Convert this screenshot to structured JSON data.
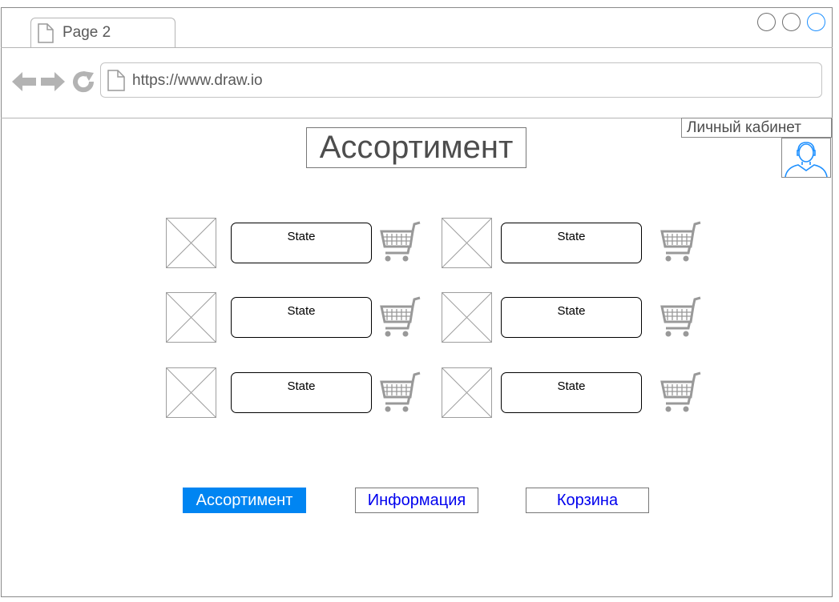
{
  "browser": {
    "tab_title": "Page 2",
    "url": "https://www.draw.io",
    "icons": [
      "file-icon",
      "back-arrow-icon",
      "forward-arrow-icon",
      "reload-icon"
    ],
    "window_controls": [
      "window-control-1",
      "window-control-2",
      "window-control-3"
    ]
  },
  "page": {
    "title": "Ассортимент",
    "account_label": "Личный кабинет"
  },
  "products": [
    {
      "state": "State"
    },
    {
      "state": "State"
    },
    {
      "state": "State"
    },
    {
      "state": "State"
    },
    {
      "state": "State"
    },
    {
      "state": "State"
    }
  ],
  "footer_nav": [
    {
      "label": "Ассортимент",
      "active": true
    },
    {
      "label": "Информация",
      "active": false
    },
    {
      "label": "Корзина",
      "active": false
    }
  ],
  "colors": {
    "accent": "#0085f2",
    "link": "#0000ee",
    "border": "#8a8a8a",
    "icon_gray": "#999999"
  }
}
